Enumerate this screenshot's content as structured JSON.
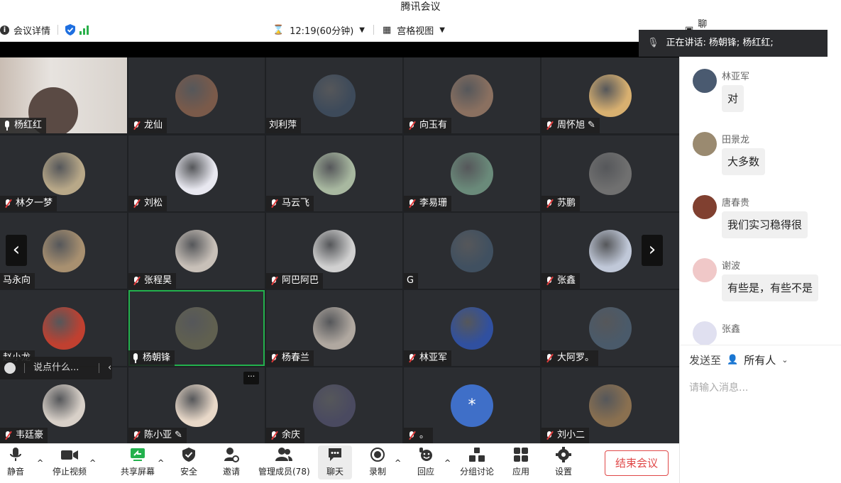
{
  "window": {
    "title": "腾讯会议"
  },
  "topbar": {
    "meeting_details": "会议详情",
    "timer": "12:19(60分钟)",
    "view_mode": "宫格视图",
    "chat_label": "聊天"
  },
  "speaking": {
    "label": "正在讲话:",
    "names": "杨朝锋; 杨红红;"
  },
  "participants": [
    {
      "name": "杨红红",
      "mic": "on"
    },
    {
      "name": "龙仙",
      "mic": "off"
    },
    {
      "name": "刘利萍",
      "mic": "none"
    },
    {
      "name": "向玉有",
      "mic": "off"
    },
    {
      "name": "周怀旭",
      "mic": "off"
    },
    {
      "name": "林夕一梦",
      "mic": "off"
    },
    {
      "name": "刘松",
      "mic": "off"
    },
    {
      "name": "马云飞",
      "mic": "off"
    },
    {
      "name": "李易珊",
      "mic": "off"
    },
    {
      "name": "苏鹏",
      "mic": "off"
    },
    {
      "name": "马永向",
      "mic": "none"
    },
    {
      "name": "张程昊",
      "mic": "off"
    },
    {
      "name": "阿巴阿巴",
      "mic": "off"
    },
    {
      "name": "G",
      "mic": "none"
    },
    {
      "name": "张鑫",
      "mic": "off"
    },
    {
      "name": "赵小龙",
      "mic": "none"
    },
    {
      "name": "杨朝锋",
      "mic": "on"
    },
    {
      "name": "杨春兰",
      "mic": "off"
    },
    {
      "name": "林亚军",
      "mic": "off"
    },
    {
      "name": "大阿罗。",
      "mic": "off"
    },
    {
      "name": "韦廷豪",
      "mic": "off"
    },
    {
      "name": "陈小亚",
      "mic": "off"
    },
    {
      "name": "余庆",
      "mic": "off"
    },
    {
      "name": "。",
      "mic": "off"
    },
    {
      "name": "刘小二",
      "mic": "off"
    }
  ],
  "chat_float": {
    "placeholder": "说点什么..."
  },
  "chat": {
    "messages": [
      {
        "name": "林亚军",
        "text": "对"
      },
      {
        "name": "田景龙",
        "text": "大多数"
      },
      {
        "name": "唐春贵",
        "text": "我们实习稳得很"
      },
      {
        "name": "谢波",
        "text": "有些是，有些不是"
      },
      {
        "name": "张鑫",
        "text": ""
      }
    ],
    "send_to_label": "发送至",
    "send_to_value": "所有人",
    "input_placeholder": "请输入消息..."
  },
  "toolbar": {
    "mute": "静音",
    "stop_video": "停止视频",
    "share": "共享屏幕",
    "security": "安全",
    "invite": "邀请",
    "members": "管理成员(78)",
    "chat": "聊天",
    "record": "录制",
    "reactions": "回应",
    "breakout": "分组讨论",
    "apps": "应用",
    "settings": "设置",
    "end": "结束会议"
  },
  "colors": {
    "accent_green": "#23b14d",
    "end_red": "#e04848",
    "grid_bg": "#2b2d31"
  }
}
